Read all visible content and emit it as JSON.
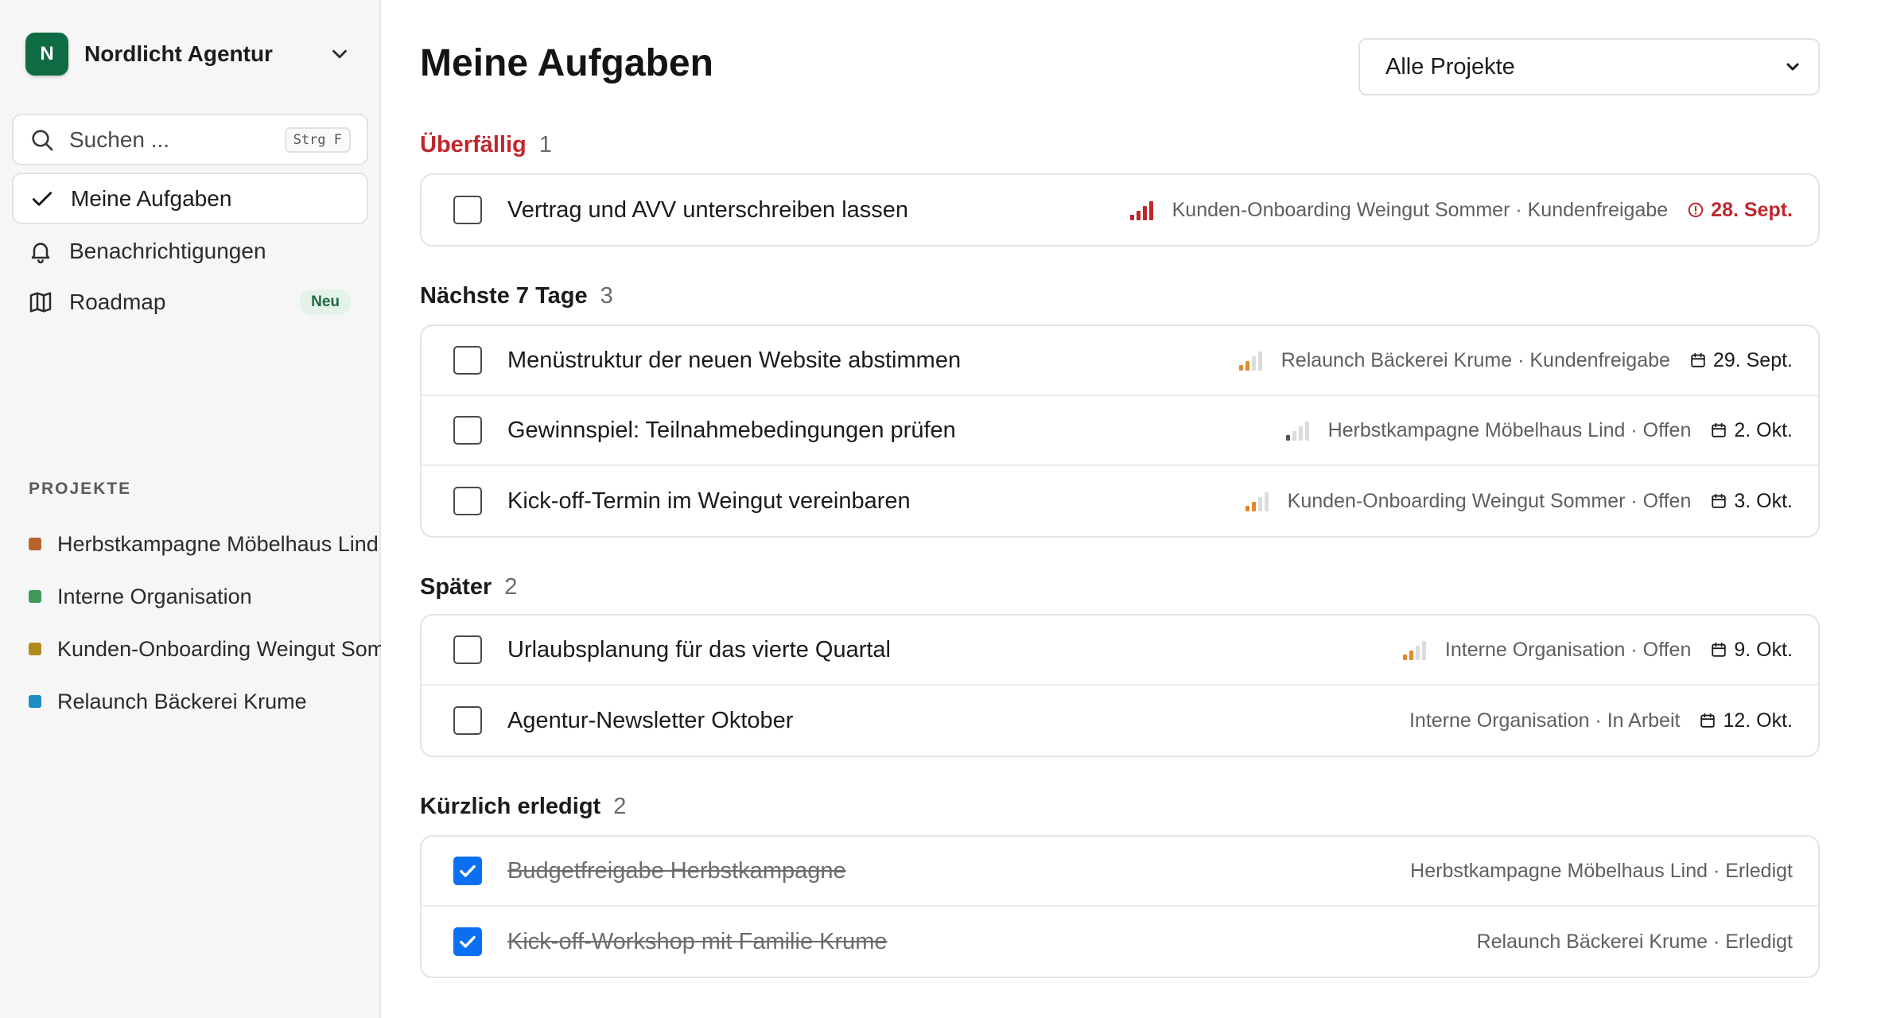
{
  "workspace": {
    "initial": "N",
    "name": "Nordlicht Agentur",
    "avatar_color": "#0f6b43"
  },
  "search": {
    "placeholder": "Suchen ...",
    "shortcut": "Strg F"
  },
  "nav": [
    {
      "label": "Meine Aufgaben",
      "icon": "check-icon",
      "active": true
    },
    {
      "label": "Benachrichtigungen",
      "icon": "bell-icon"
    },
    {
      "label": "Roadmap",
      "icon": "map-icon",
      "badge": "Neu"
    }
  ],
  "projects_title": "PROJEKTE",
  "projects": [
    {
      "name": "Herbstkampagne Möbelhaus Lind",
      "color": "#b5652b"
    },
    {
      "name": "Interne Organisation",
      "color": "#3f9a5a"
    },
    {
      "name": "Kunden-Onboarding Weingut Sommer",
      "color": "#b18a1c"
    },
    {
      "name": "Relaunch Bäckerei Krume",
      "color": "#1b8cc4"
    }
  ],
  "page_title": "Meine Aufgaben",
  "filter": {
    "selected": "Alle Projekte"
  },
  "colors": {
    "overdue": "#c0272d",
    "checkbox_checked": "#0b6ff2",
    "priority_medium": "#e08a2c"
  },
  "groups": [
    {
      "name": "Überfällig",
      "count": "1",
      "overdue": true,
      "tasks": [
        {
          "title": "Vertrag und AVV unterschreiben lassen",
          "priority": 4,
          "meta": "Kunden-Onboarding Weingut Sommer · Kundenfreigabe",
          "due": "28. Sept.",
          "overdue": true
        }
      ]
    },
    {
      "name": "Nächste 7 Tage",
      "count": "3",
      "tasks": [
        {
          "title": "Menüstruktur der neuen Website abstimmen",
          "priority": 2,
          "meta": "Relaunch Bäckerei Krume · Kundenfreigabe",
          "due": "29. Sept."
        },
        {
          "title": "Gewinnspiel: Teilnahmebedingungen prüfen",
          "priority": 1,
          "meta": "Herbstkampagne Möbelhaus Lind · Offen",
          "due": "2. Okt."
        },
        {
          "title": "Kick-off-Termin im Weingut vereinbaren",
          "priority": 2,
          "meta": "Kunden-Onboarding Weingut Sommer · Offen",
          "due": "3. Okt."
        }
      ]
    },
    {
      "name": "Später",
      "count": "2",
      "tasks": [
        {
          "title": "Urlaubsplanung für das vierte Quartal",
          "priority": 2,
          "meta": "Interne Organisation · Offen",
          "due": "9. Okt."
        },
        {
          "title": "Agentur-Newsletter Oktober",
          "priority": 0,
          "meta": "Interne Organisation · In Arbeit",
          "due": "12. Okt."
        }
      ]
    },
    {
      "name": "Kürzlich erledigt",
      "count": "2",
      "tasks": [
        {
          "title": "Budgetfreigabe Herbstkampagne",
          "done": true,
          "meta": "Herbstkampagne Möbelhaus Lind · Erledigt"
        },
        {
          "title": "Kick-off-Workshop mit Familie Krume",
          "done": true,
          "meta": "Relaunch Bäckerei Krume · Erledigt"
        }
      ]
    }
  ]
}
